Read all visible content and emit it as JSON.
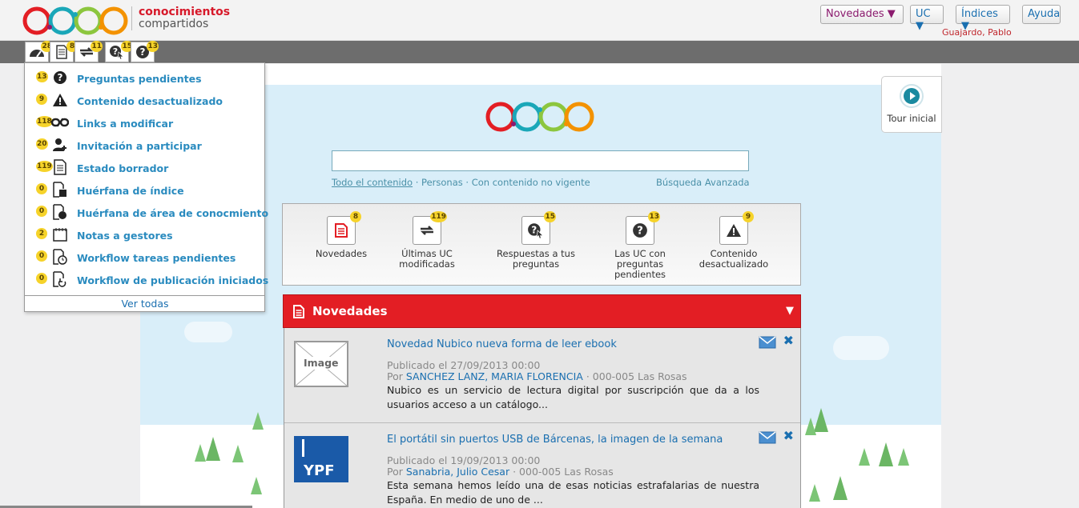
{
  "brand": {
    "line1": "conocimientos",
    "line2": "compartidos"
  },
  "topnav": {
    "novedades": "Novedades ▼",
    "uc": "UC ▼",
    "indices": "Índices ▼",
    "ayuda": "Ayuda"
  },
  "user": "Guajardo, Pablo",
  "toolbar": [
    {
      "icon": "dashboard-icon",
      "badge": "28"
    },
    {
      "icon": "document-icon",
      "badge": "8"
    },
    {
      "icon": "refresh-icon",
      "badge": "11"
    },
    {
      "icon": "question-cursor-icon",
      "badge": "15"
    },
    {
      "icon": "question-icon",
      "badge": "13"
    }
  ],
  "dropdown": {
    "items": [
      {
        "badge": "13",
        "icon": "question-icon",
        "label": "Preguntas pendientes"
      },
      {
        "badge": "9",
        "icon": "warning-icon",
        "label": "Contenido desactualizado"
      },
      {
        "badge": "118",
        "icon": "broken-link-icon",
        "label": "Links a modificar"
      },
      {
        "badge": "20",
        "icon": "add-user-icon",
        "label": "Invitación a participar"
      },
      {
        "badge": "119",
        "icon": "draft-document-icon",
        "label": "Estado borrador"
      },
      {
        "badge": "0",
        "icon": "orphan-index-icon",
        "label": "Huérfana de índice"
      },
      {
        "badge": "0",
        "icon": "orphan-area-icon",
        "label": "Huérfana de área de conocmiento"
      },
      {
        "badge": "2",
        "icon": "calendar-icon",
        "label": "Notas a gestores"
      },
      {
        "badge": "0",
        "icon": "workflow-clock-icon",
        "label": "Workflow tareas pendientes"
      },
      {
        "badge": "0",
        "icon": "workflow-publish-icon",
        "label": "Workflow de publicación iniciados"
      }
    ],
    "ver_todas": "Ver todas"
  },
  "search": {
    "value": "",
    "link_all": "Todo el contenido",
    "link_people": "Personas",
    "link_vigente": "Con contenido no vigente",
    "advanced": "Búsqueda Avanzada"
  },
  "shortcuts": [
    {
      "badge": "8",
      "label": "Novedades",
      "icon": "document-icon"
    },
    {
      "badge": "119",
      "label": "Últimas UC modificadas",
      "icon": "refresh-icon"
    },
    {
      "badge": "15",
      "label": "Respuestas a tus preguntas",
      "icon": "question-cursor-icon"
    },
    {
      "badge": "13",
      "label": "Las UC con preguntas pendientes",
      "icon": "question-icon"
    },
    {
      "badge": "9",
      "label": "Contenido desactualizado",
      "icon": "warning-icon"
    }
  ],
  "novedades": {
    "title": "Novedades",
    "items": [
      {
        "title": "Novedad Nubico nueva forma de leer ebook",
        "published": "Publicado el 27/09/2013 00:00",
        "por": "Por",
        "author": "SANCHEZ LANZ, MARIA FLORENCIA",
        "location": "· 000-005 Las Rosas",
        "desc": " Nubico es un servicio de lectura digital por suscripción que da a los usuarios acceso a un catálogo...",
        "thumb": "Image"
      },
      {
        "title": "El portátil sin puertos USB de Bárcenas, la imagen de la semana",
        "published": "Publicado el 19/09/2013 00:00",
        "por": "Por",
        "author": "Sanabria, Julio Cesar",
        "location": "· 000-005 Las Rosas",
        "desc": "  Esta semana hemos leído una de esas noticias estrafalarias de nuestra España. En medio de uno de ...",
        "thumb": "YPF"
      }
    ]
  },
  "tour": "Tour inicial",
  "colors": {
    "red": "#e31e24",
    "link": "#1a6fb0",
    "badge": "#f6d32a"
  }
}
